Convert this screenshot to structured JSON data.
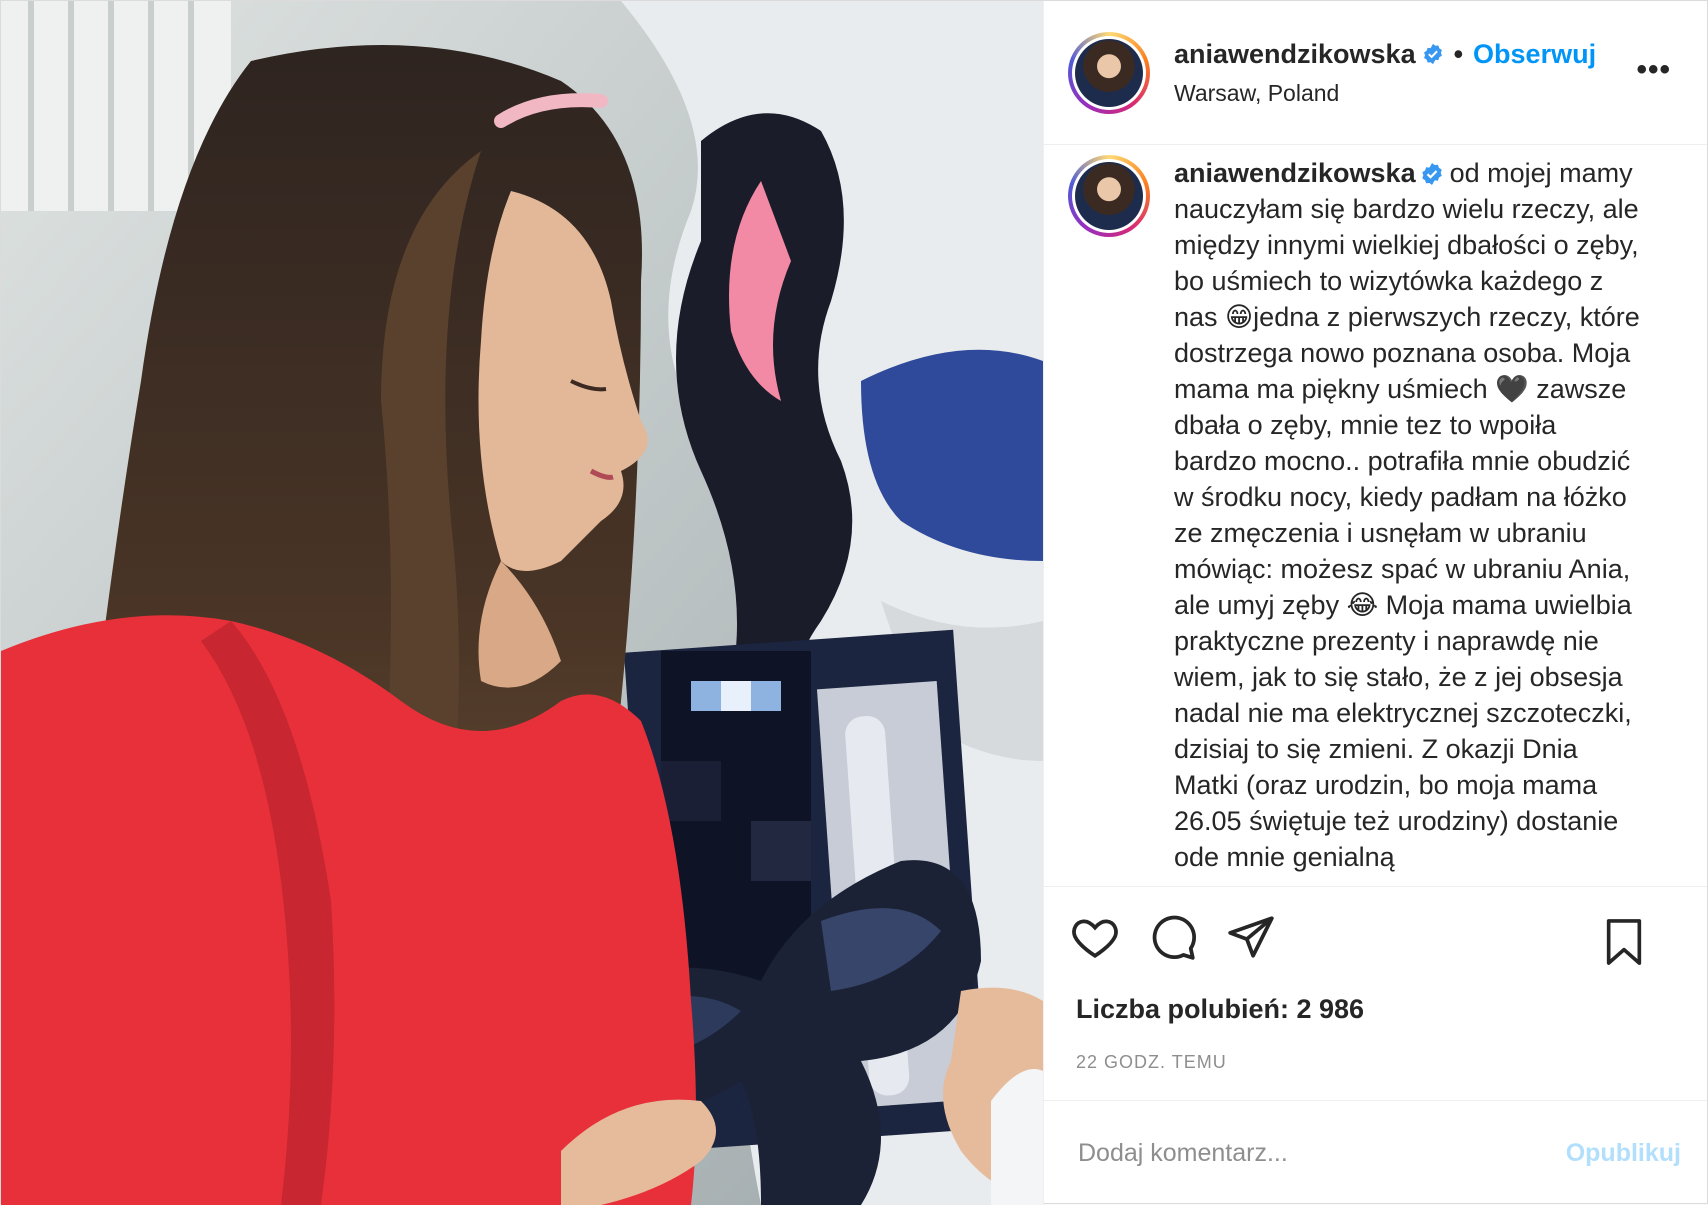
{
  "post": {
    "username": "aniawendzikowska",
    "follow_label": "Obserwuj",
    "separator": "•",
    "location": "Warsaw, Poland",
    "more_label": "•••",
    "verified_icon": "verified-badge-icon",
    "photo_description_icon": "post-photo"
  },
  "caption": {
    "username": "aniawendzikowska",
    "text": "od mojej mamy nauczyłam się bardzo wielu rzeczy, ale między innymi wielkiej dbałości o zęby, bo uśmiech to wizytówka każdego z nas 😁jedna z pierwszych rzeczy, które dostrzega nowo poznana osoba. Moja mama ma piękny uśmiech 🖤 zawsze dbała o zęby, mnie tez to wpoiła bardzo mocno.. potrafiła mnie obudzić w środku nocy, kiedy padłam na łóżko ze zmęczenia i usnęłam w ubraniu mówiąc: możesz spać w ubraniu Ania, ale umyj zęby 😂 Moja mama uwielbia praktyczne prezenty i naprawdę nie wiem, jak to się stało, że z jej obsesja nadal nie ma elektrycznej szczoteczki, dzisiaj to się zmieni. Z okazji Dnia Matki (oraz urodzin, bo moja mama 26.05 świętuje też urodziny) dostanie ode mnie genialną"
  },
  "actions": {
    "like_icon": "heart-icon",
    "comment_icon": "comment-icon",
    "share_icon": "paper-plane-icon",
    "save_icon": "bookmark-icon"
  },
  "stats": {
    "likes": "Liczba polubień: 2 986",
    "time": "22 GODZ. TEMU"
  },
  "comment_box": {
    "placeholder": "Dodaj komentarz...",
    "publish_label": "Opublikuj"
  },
  "colors": {
    "accent": "#0095f6",
    "publish_disabled": "#b2dffc",
    "dress": "#e8303a",
    "text": "#262626",
    "muted": "#8e8e8e"
  }
}
